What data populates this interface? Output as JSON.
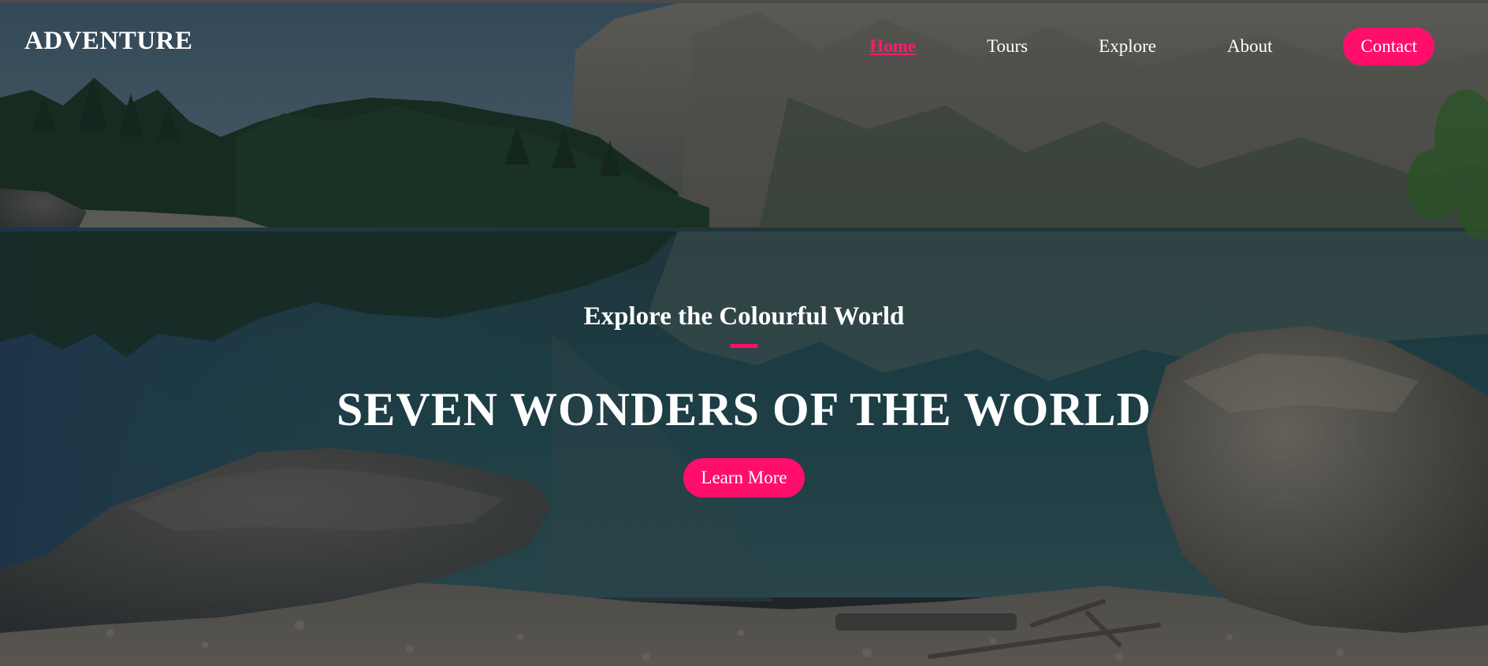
{
  "brand": {
    "logo_text": "ADVENTURE"
  },
  "nav": {
    "items": [
      {
        "label": "Home",
        "active": true
      },
      {
        "label": "Tours",
        "active": false
      },
      {
        "label": "Explore",
        "active": false
      },
      {
        "label": "About",
        "active": false
      }
    ],
    "contact_label": "Contact"
  },
  "hero": {
    "subtitle": "Explore the Colourful World",
    "title": "SEVEN WONDERS OF THE WORLD",
    "cta_label": "Learn More"
  },
  "colors": {
    "accent": "#ff0f6b",
    "text": "#ffffff"
  },
  "background": {
    "subject": "mountain-lake-landscape"
  }
}
